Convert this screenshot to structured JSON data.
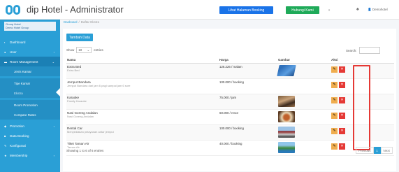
{
  "header": {
    "app_title": "dip Hotel - Administrator",
    "booking_button": "Lihat Halaman Booking",
    "whatsapp_button": "Hubungi Kami",
    "flag_badge": "",
    "user_label": "Demohotel"
  },
  "sidebar": {
    "hotel_group_label": "Group Hotel",
    "hotel_name": "Demo Hotel Group",
    "items": [
      {
        "label": "Dashboard",
        "icon": "dashboard-icon"
      },
      {
        "label": "User",
        "icon": "user-icon"
      },
      {
        "label": "Room Management",
        "icon": "bed-icon"
      },
      {
        "label": "Jenis Kamar"
      },
      {
        "label": "Tipe Kamar"
      },
      {
        "label": "Ekstra"
      },
      {
        "label": "Room Promotion"
      },
      {
        "label": "Compare Rates"
      },
      {
        "label": "Promotion",
        "icon": "tag-icon"
      },
      {
        "label": "Data Booking",
        "icon": "book-icon"
      },
      {
        "label": "Konfigurasi",
        "icon": "wrench-icon"
      },
      {
        "label": "Membership",
        "icon": "star-icon"
      }
    ]
  },
  "breadcrumb": {
    "home": "Dasboard",
    "current": "Daftar Ekstra"
  },
  "main": {
    "add_button": "Tambah Data",
    "show_label": "Show",
    "show_value": "10",
    "entries_label": "entries",
    "search_label": "Search:",
    "columns": [
      "Nama",
      "Harga",
      "Gambar",
      "Aksi"
    ],
    "rows": [
      {
        "name": "Extra Bed",
        "desc": "Extra Bed",
        "price": "126.226 / malam",
        "has_image": true
      },
      {
        "name": "Jemput Bandara",
        "desc": "Jemput Bandara dari jam 6 pagi sampai jam 6 sore",
        "price": "100.000 / booking",
        "has_image": false
      },
      {
        "name": "Karaoke",
        "desc": "Family Karaoke",
        "price": "75.000 / jam",
        "has_image": true
      },
      {
        "name": "Nasi Goreng Andalan",
        "desc": "Nasi Goreng Andalan",
        "price": "60.000 / resor",
        "has_image": true
      },
      {
        "name": "Rental Car",
        "desc": "Menyediakan pelayanan antar jemput",
        "price": "100.000 / booking",
        "has_image": true
      },
      {
        "name": "Tiket Taman Air",
        "desc": "Taman Air",
        "price": "40.000 / booking",
        "has_image": true
      }
    ],
    "info": "Showing 1 to 6 of 6 entries",
    "pager": {
      "prev": "Previous",
      "current": "1",
      "next": "Next"
    }
  }
}
